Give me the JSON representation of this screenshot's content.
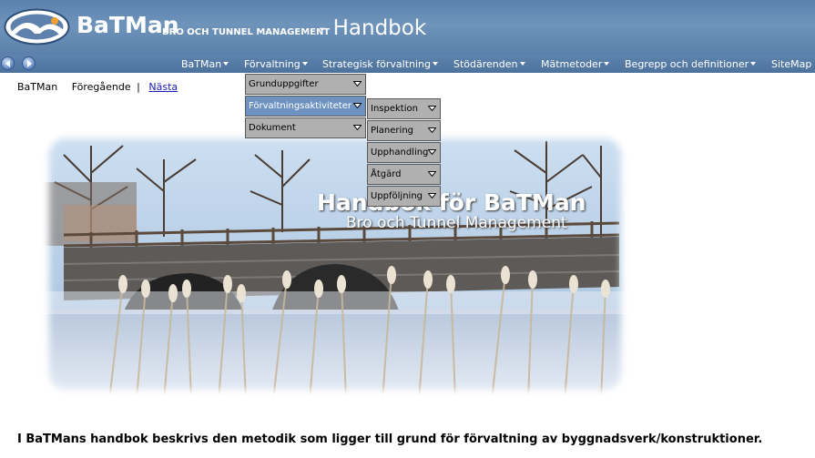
{
  "header": {
    "brand": "BaTMan",
    "brand_sub": "BRO OCH TUNNEL MANAGEMENT",
    "page_title": "- Handbok"
  },
  "nav": {
    "items": [
      {
        "label": "BaTMan"
      },
      {
        "label": "Förvaltning"
      },
      {
        "label": "Strategisk förvaltning"
      },
      {
        "label": "Stödärenden"
      },
      {
        "label": "Mätmetoder"
      },
      {
        "label": "Begrepp och definitioner"
      },
      {
        "label": "SiteMap"
      }
    ]
  },
  "crumbs": {
    "home": "BaTMan",
    "prev": "Föregående",
    "sep": "|",
    "next": "Nästa"
  },
  "menu_level1": [
    {
      "label": "Grunduppgifter"
    },
    {
      "label": "Förvaltningsaktiviteter"
    },
    {
      "label": "Dokument"
    }
  ],
  "menu_level2": [
    {
      "label": "Inspektion"
    },
    {
      "label": "Planering"
    },
    {
      "label": "Upphandling"
    },
    {
      "label": "Åtgärd"
    },
    {
      "label": "Uppföljning"
    }
  ],
  "hero": {
    "title": "Handbok för BaTMan",
    "subtitle": "Bro och Tunnel Management"
  },
  "intro": "I BaTMans handbok beskrivs den metodik som ligger till grund för förvaltning av byggnadsverk/konstruktioner."
}
